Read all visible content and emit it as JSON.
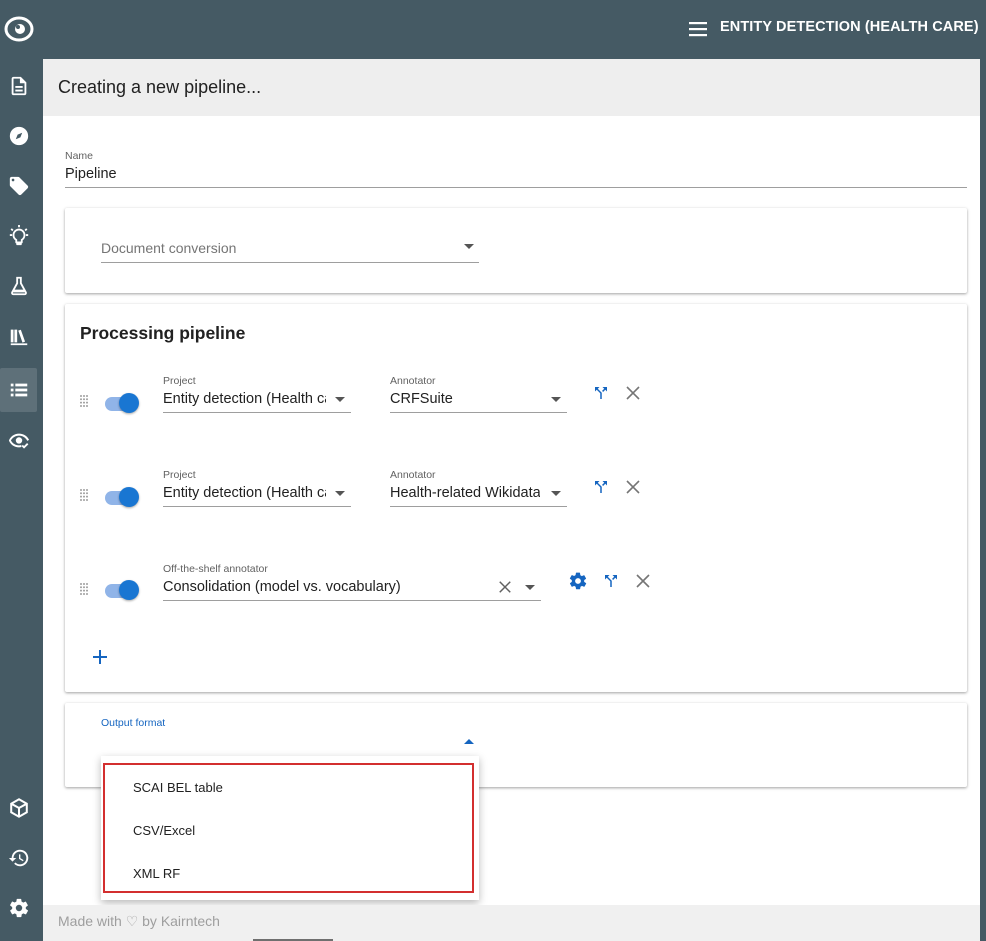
{
  "topbar": {
    "project_title": "ENTITY DETECTION (HEALTH CARE)"
  },
  "page": {
    "title": "Creating a new pipeline..."
  },
  "name_field": {
    "label": "Name",
    "value": "Pipeline"
  },
  "document_conversion": {
    "placeholder": "Document conversion"
  },
  "processing": {
    "title": "Processing pipeline",
    "steps": [
      {
        "project_label": "Project",
        "project_value": "Entity detection (Health care)",
        "annotator_label": "Annotator",
        "annotator_value": "CRFSuite"
      },
      {
        "project_label": "Project",
        "project_value": "Entity detection (Health care)",
        "annotator_label": "Annotator",
        "annotator_value": "Health-related Wikidata"
      },
      {
        "offshelf_label": "Off-the-shelf annotator",
        "offshelf_value": "Consolidation (model vs. vocabulary)"
      }
    ]
  },
  "output_format": {
    "label": "Output format",
    "options": [
      "SCAI BEL table",
      "CSV/Excel",
      "XML RF"
    ]
  },
  "footer": {
    "text": "Made with ♡ by Kairntech"
  },
  "colors": {
    "sidebar": "#455a64",
    "accent": "#1976d2",
    "highlight": "#d32f2f"
  },
  "icons": [
    "eye-logo-icon",
    "document-icon",
    "compass-icon",
    "tag-icon",
    "lightbulb-icon",
    "flask-icon",
    "library-icon",
    "list-icon",
    "eye-check-icon",
    "cube-icon",
    "history-icon",
    "gear-icon",
    "menu-icon",
    "fork-icon",
    "close-icon",
    "settings-icon",
    "plus-icon",
    "drag-handle-icon"
  ]
}
